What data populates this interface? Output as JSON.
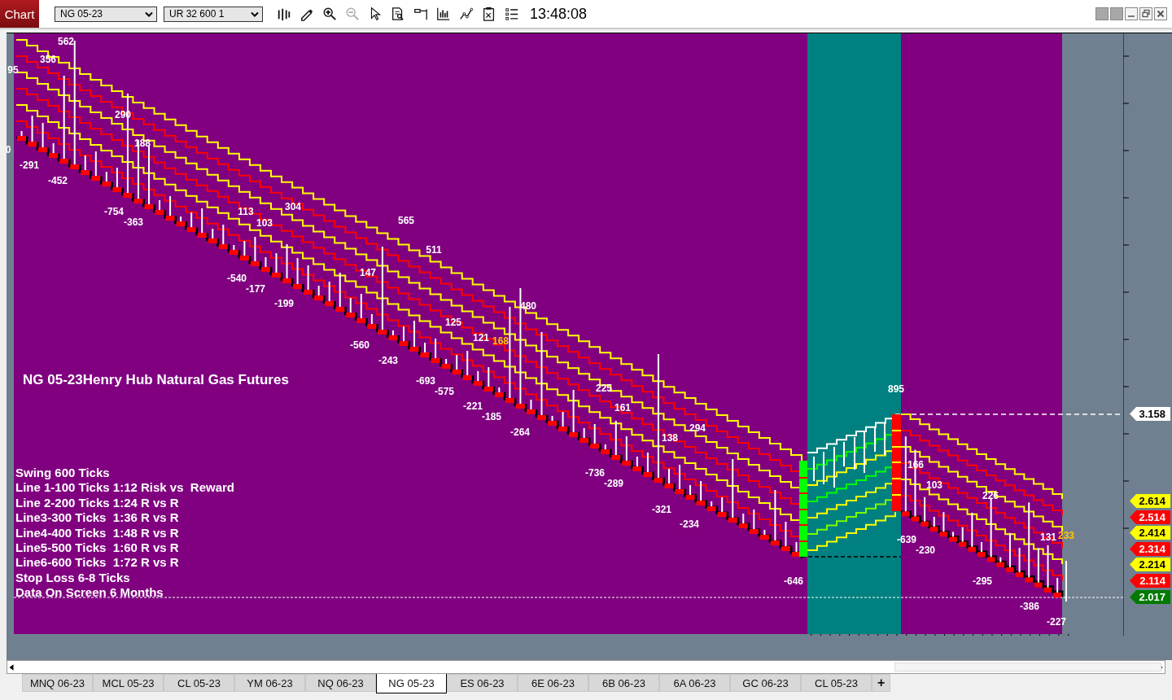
{
  "toolbar": {
    "chart_button": "Chart",
    "symbol": "NG 05-23",
    "bar_type": "UR 32 600 1",
    "tools": [
      {
        "kind": "bars",
        "disabled": false
      },
      {
        "kind": "pencil",
        "disabled": false
      },
      {
        "kind": "zoomin",
        "disabled": false
      },
      {
        "kind": "zoomout",
        "disabled": true
      },
      {
        "kind": "pointer",
        "disabled": false
      },
      {
        "kind": "docsearch",
        "disabled": false
      },
      {
        "kind": "flag",
        "disabled": false
      },
      {
        "kind": "barchart",
        "disabled": false
      },
      {
        "kind": "linechart",
        "disabled": false
      },
      {
        "kind": "clipboard",
        "disabled": false
      },
      {
        "kind": "list",
        "disabled": false
      }
    ],
    "time": "13:48:08"
  },
  "chart": {
    "title": "NG 05-23Henry Hub Natural Gas Futures",
    "legend": [
      "Swing 600 Ticks",
      "Line 1-100 Ticks 1:12 Risk vs  Reward",
      "Line 2-200 Ticks 1:24 R vs R",
      "Line3-300 Ticks  1:36 R vs R",
      "Line4-400 Ticks  1:48 R vs R",
      "Line5-500 Ticks  1:60 R vs R",
      "Line6-600 Ticks  1:72 R vs R",
      "Stop Loss 6-8 Ticks",
      "Data On Screen 6 Months"
    ],
    "swing_labels": [
      {
        "text": "562",
        "color": "#ffffff"
      },
      {
        "text": "356",
        "color": "#ffffff"
      },
      {
        "text": "95",
        "color": "#ffffff"
      },
      {
        "text": "0",
        "color": "#ffffff"
      },
      {
        "text": "-291",
        "color": "#ffffff"
      },
      {
        "text": "-452",
        "color": "#ffffff"
      },
      {
        "text": "290",
        "color": "#ffffff"
      },
      {
        "text": "188",
        "color": "#ffffff"
      },
      {
        "text": "-754",
        "color": "#ffffff"
      },
      {
        "text": "-363",
        "color": "#ffffff"
      },
      {
        "text": "113",
        "color": "#ffffff"
      },
      {
        "text": "103",
        "color": "#ffffff"
      },
      {
        "text": "304",
        "color": "#ffffff"
      },
      {
        "text": "-540",
        "color": "#ffffff"
      },
      {
        "text": "-177",
        "color": "#ffffff"
      },
      {
        "text": "-199",
        "color": "#ffffff"
      },
      {
        "text": "565",
        "color": "#ffffff"
      },
      {
        "text": "511",
        "color": "#ffffff"
      },
      {
        "text": "147",
        "color": "#ffffff"
      },
      {
        "text": "-560",
        "color": "#ffffff"
      },
      {
        "text": "-243",
        "color": "#ffffff"
      },
      {
        "text": "125",
        "color": "#ffffff"
      },
      {
        "text": "121",
        "color": "#ffffff"
      },
      {
        "text": "168",
        "color": "#ffc800"
      },
      {
        "text": "480",
        "color": "#ffffff"
      },
      {
        "text": "-693",
        "color": "#ffffff"
      },
      {
        "text": "-575",
        "color": "#ffffff"
      },
      {
        "text": "-221",
        "color": "#ffffff"
      },
      {
        "text": "-185",
        "color": "#ffffff"
      },
      {
        "text": "-264",
        "color": "#ffffff"
      },
      {
        "text": "225",
        "color": "#ffffff"
      },
      {
        "text": "161",
        "color": "#ffffff"
      },
      {
        "text": "138",
        "color": "#ffffff"
      },
      {
        "text": "294",
        "color": "#ffffff"
      },
      {
        "text": "-736",
        "color": "#ffffff"
      },
      {
        "text": "-289",
        "color": "#ffffff"
      },
      {
        "text": "-321",
        "color": "#ffffff"
      },
      {
        "text": "-234",
        "color": "#ffffff"
      },
      {
        "text": "-646",
        "color": "#ffffff"
      },
      {
        "text": "895",
        "color": "#ffffff"
      },
      {
        "text": "166",
        "color": "#ffffff"
      },
      {
        "text": "103",
        "color": "#ffffff"
      },
      {
        "text": "-639",
        "color": "#ffffff"
      },
      {
        "text": "-230",
        "color": "#ffffff"
      },
      {
        "text": "226",
        "color": "#ffffff"
      },
      {
        "text": "131",
        "color": "#ffffff"
      },
      {
        "text": "233",
        "color": "#ffc800"
      },
      {
        "text": "-295",
        "color": "#ffffff"
      },
      {
        "text": "-386",
        "color": "#ffffff"
      },
      {
        "text": "-227",
        "color": "#ffffff"
      }
    ],
    "price_badges": [
      {
        "text": "3.158",
        "color": "#ffffff"
      },
      {
        "text": "2.614",
        "color": "#ffff00"
      },
      {
        "text": "2.514",
        "color": "#ff0000"
      },
      {
        "text": "2.414",
        "color": "#ffff00"
      },
      {
        "text": "2.314",
        "color": "#ff0000"
      },
      {
        "text": "2.214",
        "color": "#ffff00"
      },
      {
        "text": "2.114",
        "color": "#ff0000"
      },
      {
        "text": "2.017",
        "color": "#007a00"
      }
    ]
  },
  "tabs": [
    {
      "label": "MNQ 06-23",
      "selected": false
    },
    {
      "label": "MCL 05-23",
      "selected": false
    },
    {
      "label": "CL 05-23",
      "selected": false
    },
    {
      "label": "YM 06-23",
      "selected": false
    },
    {
      "label": "NQ 06-23",
      "selected": false
    },
    {
      "label": "NG 05-23",
      "selected": true
    },
    {
      "label": "ES 06-23",
      "selected": false
    },
    {
      "label": "6E 06-23",
      "selected": false
    },
    {
      "label": "6B 06-23",
      "selected": false
    },
    {
      "label": "6A 06-23",
      "selected": false
    },
    {
      "label": "GC 06-23",
      "selected": false
    },
    {
      "label": "CL 05-23",
      "selected": false
    }
  ],
  "add_tab": "+"
}
